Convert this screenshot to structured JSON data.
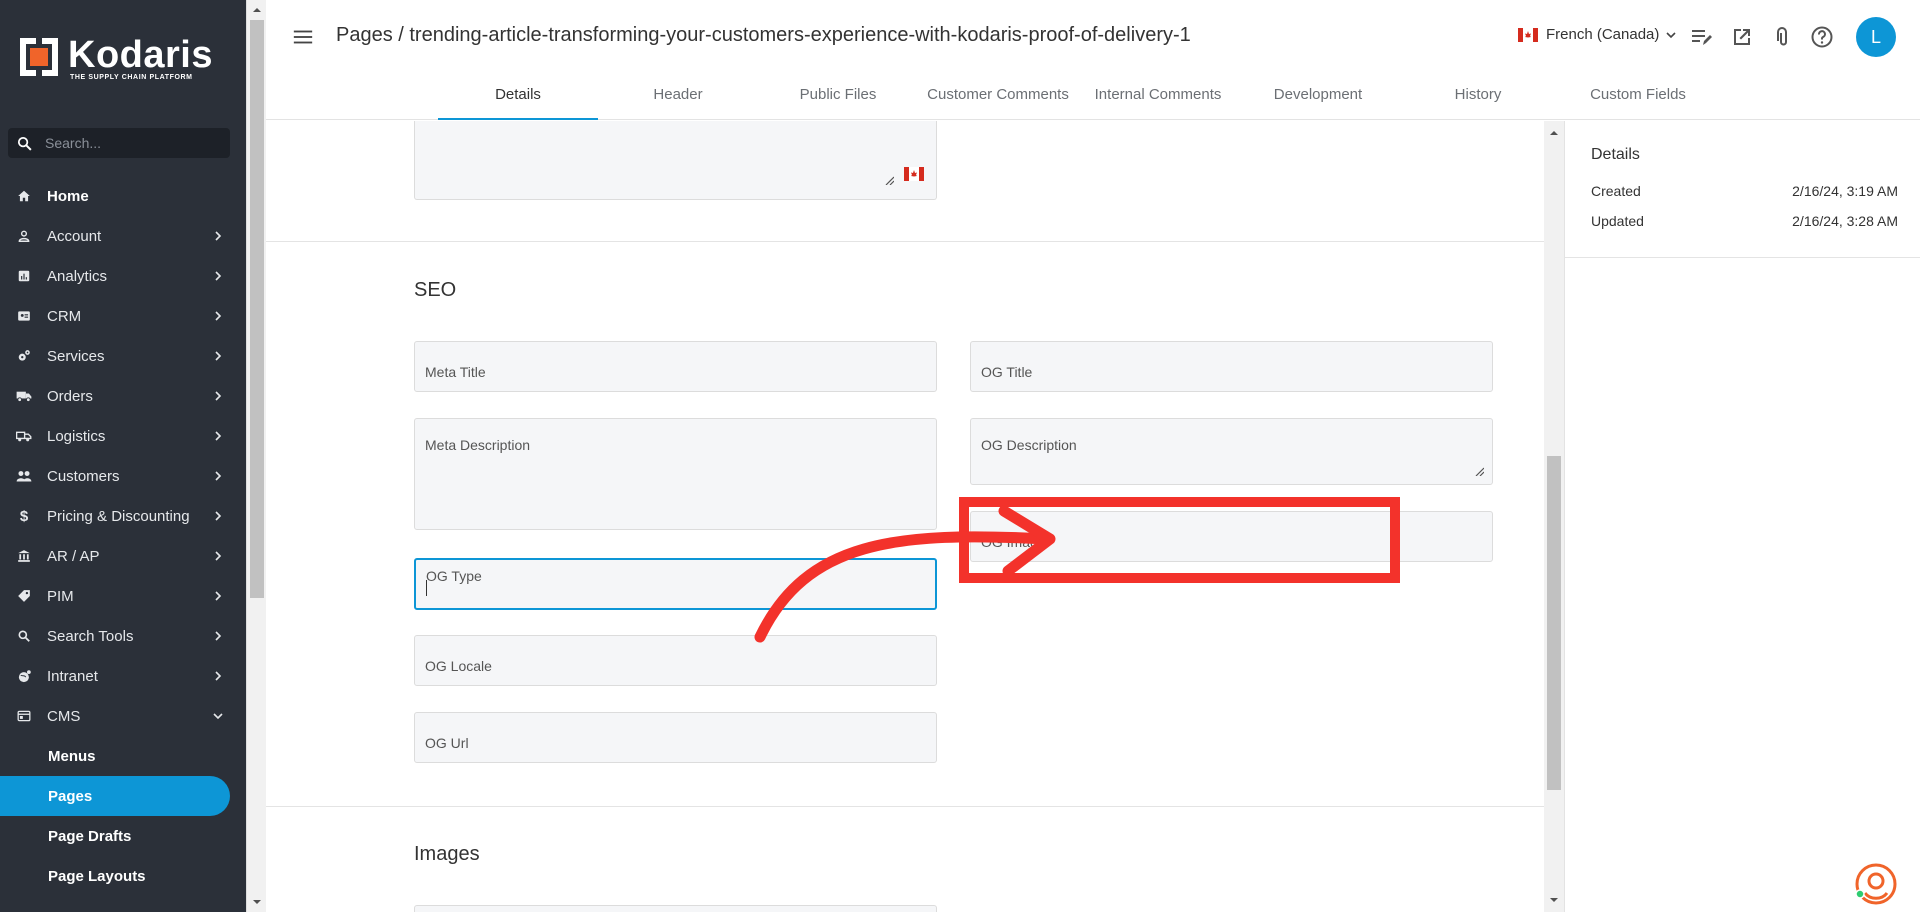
{
  "brand": {
    "name": "Kodaris",
    "tagline": "THE SUPPLY CHAIN PLATFORM"
  },
  "colors": {
    "sidebar": "#2b3039",
    "accent": "#0d96d6",
    "highlight": "#f3322b"
  },
  "search": {
    "placeholder": "Search..."
  },
  "nav": [
    {
      "label": "Home",
      "icon": "home-icon"
    },
    {
      "label": "Account",
      "icon": "account-icon"
    },
    {
      "label": "Analytics",
      "icon": "analytics-icon"
    },
    {
      "label": "CRM",
      "icon": "crm-icon"
    },
    {
      "label": "Services",
      "icon": "services-icon"
    },
    {
      "label": "Orders",
      "icon": "truck-icon"
    },
    {
      "label": "Logistics",
      "icon": "logistics-icon"
    },
    {
      "label": "Customers",
      "icon": "customers-icon"
    },
    {
      "label": "Pricing & Discounting",
      "icon": "dollar-icon"
    },
    {
      "label": "AR / AP",
      "icon": "bank-icon"
    },
    {
      "label": "PIM",
      "icon": "tag-icon"
    },
    {
      "label": "Search Tools",
      "icon": "search-icon"
    },
    {
      "label": "Intranet",
      "icon": "intranet-icon"
    },
    {
      "label": "CMS",
      "icon": "cms-icon"
    }
  ],
  "cms_sub": [
    "Menus",
    "Pages",
    "Page Drafts",
    "Page Layouts"
  ],
  "header": {
    "title": "Pages / trending-article-transforming-your-customers-experience-with-kodaris-proof-of-delivery-1",
    "language": "French (Canada)",
    "avatar": "L"
  },
  "tabs": [
    "Details",
    "Header",
    "Public Files",
    "Customer Comments",
    "Internal Comments",
    "Development",
    "History",
    "Custom Fields"
  ],
  "seo": {
    "title": "SEO",
    "meta_title": "Meta Title",
    "og_title": "OG Title",
    "meta_description": "Meta Description",
    "og_description": "OG Description",
    "og_image": "OG Image",
    "og_type": "OG Type",
    "og_locale": "OG Locale",
    "og_url": "OG Url"
  },
  "images": {
    "title": "Images"
  },
  "details": {
    "title": "Details",
    "created_label": "Created",
    "created_value": "2/16/24, 3:19 AM",
    "updated_label": "Updated",
    "updated_value": "2/16/24, 3:28 AM"
  }
}
